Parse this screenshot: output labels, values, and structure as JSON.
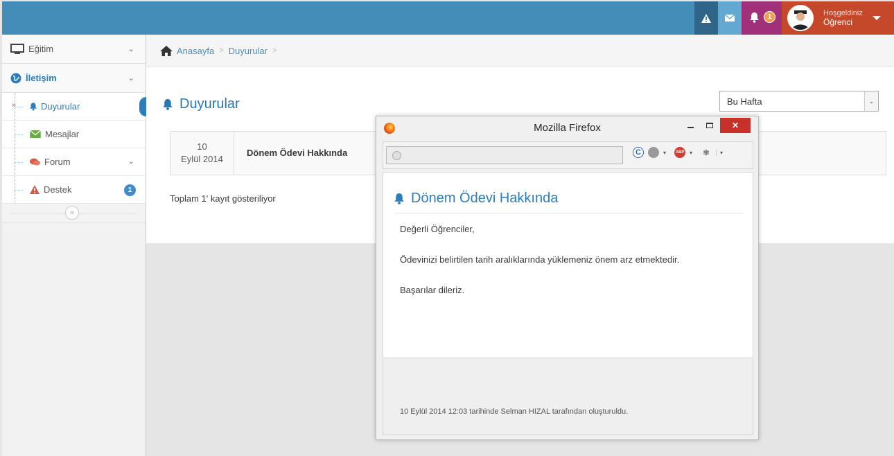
{
  "navbar": {
    "bell_badge": "1",
    "greeting": "Hoşgeldiniz",
    "user_name": "Öğrenci"
  },
  "sidebar": {
    "items": [
      {
        "label": "Eğitim"
      },
      {
        "label": "İletişim"
      }
    ],
    "sub_items": [
      {
        "label": "Duyurular"
      },
      {
        "label": "Mesajlar"
      },
      {
        "label": "Forum"
      },
      {
        "label": "Destek",
        "badge": "1"
      }
    ]
  },
  "breadcrumbs": [
    "Anasayfa",
    "Duyurular"
  ],
  "main": {
    "title": "Duyurular",
    "filter_selected": "Bu Hafta",
    "table": {
      "rows": [
        {
          "date_day": "10",
          "date_month_year": "Eylül 2014",
          "title": "Dönem Ödevi Hakkında"
        }
      ]
    },
    "total_text": "Toplam 1' kayıt gösteriliyor"
  },
  "popup": {
    "window_title": "Mozilla Firefox",
    "heading": "Dönem Ödevi Hakkında",
    "paragraphs": [
      "Değerli Öğrenciler,",
      "Ödevinizi belirtilen tarih aralıklarında yüklemeniz önem arz etmektedir.",
      "Başarılar dileriz."
    ],
    "footer": "10 Eylül 2014 12:03 tarihinde Selman HIZAL tarafından oluşturuldu."
  },
  "colors": {
    "navbar": "#438eb9",
    "accent": "#2b7dbc",
    "bell_bg": "#a0307a",
    "user_bg": "#c6482b",
    "close_btn": "#c8302a"
  }
}
